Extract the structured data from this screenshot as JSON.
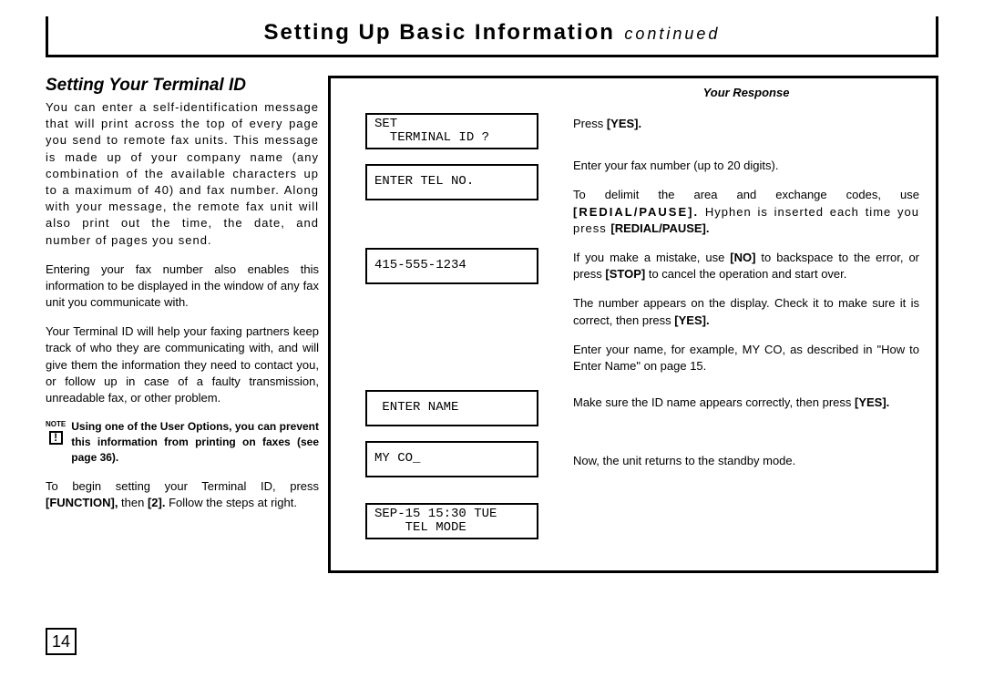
{
  "header": {
    "title": "Setting Up Basic Information",
    "continued": "continued"
  },
  "section_title": "Setting Your Terminal ID",
  "paragraphs": {
    "p1": "You can enter a self-identification message that will print across the top of every page you send to remote fax units. This message is made up of your company name (any combination of the available characters up to a maximum of 40) and fax number. Along with your message, the remote fax unit will also print out the time, the date, and number of pages you send.",
    "p2": "Entering your fax number also enables this information to be displayed in the window of any fax unit you communicate with.",
    "p3": "Your Terminal ID will help your faxing partners keep track of who they are communicating with, and will give them the information they need to contact you, or follow up in case of a faulty transmission, unreadable fax, or other problem."
  },
  "note": {
    "label_small": "NOTE",
    "icon": "!",
    "text": "Using one of the User Options, you can prevent this information from printing on faxes (see page 36)."
  },
  "begin_text_pre": "To begin setting your Terminal ID, press ",
  "begin_func": "[FUNCTION],",
  "begin_then": " then ",
  "begin_two": "[2].",
  "begin_tail": " Follow the steps at right.",
  "response_header": "Your Response",
  "lcd": {
    "d1l1": "SET",
    "d1l2": "  TERMINAL ID ?",
    "d2": "ENTER TEL NO.",
    "d3": "415-555-1234",
    "d4": " ENTER NAME",
    "d5": "MY CO_",
    "d6l1": "SEP-15 15:30 TUE",
    "d6l2": "    TEL MODE"
  },
  "resp": {
    "r1_pre": "Press ",
    "r1_yes": "[YES].",
    "r2": "Enter your fax number (up to 20 digits).",
    "r3_pre": "To delimit the area and exchange codes, use ",
    "r3_rp": "[REDIAL/PAUSE].",
    "r3_mid": " Hyphen is inserted each time you press ",
    "r3_rp2": "[REDIAL/PAUSE].",
    "r4_pre": "If you make a mistake, use ",
    "r4_no": "[NO]",
    "r4_mid": " to backspace to the error, or press ",
    "r4_stop": "[STOP]",
    "r4_tail": " to cancel the operation and start over.",
    "r5_pre": "The number appears on the display. Check it to make sure it is correct, then press ",
    "r5_yes": "[YES].",
    "r6": "Enter your name, for example, MY CO, as described in \"How to Enter Name\" on page 15.",
    "r7_pre": "Make sure the ID name appears correctly, then press ",
    "r7_yes": "[YES].",
    "r8": "Now, the unit returns to the standby mode."
  },
  "page_number": "14"
}
